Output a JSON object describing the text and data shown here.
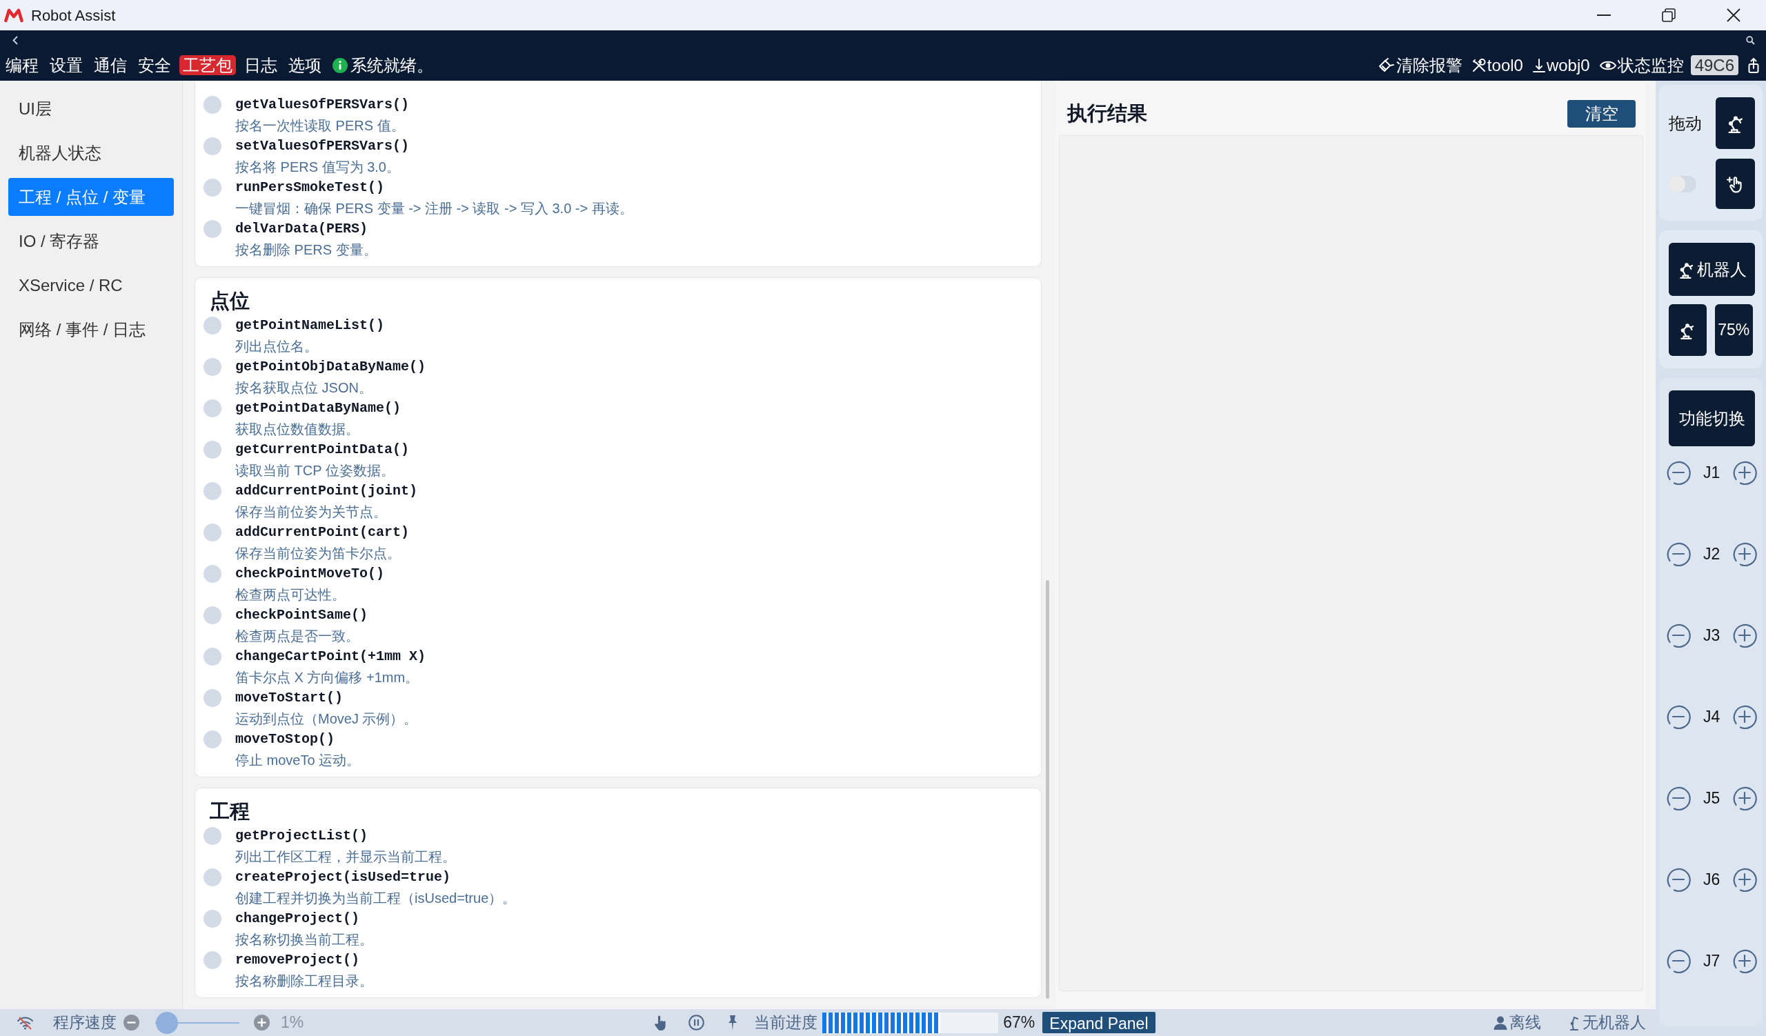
{
  "window": {
    "title": "Robot Assist"
  },
  "menu": [
    {
      "label": "编程",
      "selected": false
    },
    {
      "label": "设置",
      "selected": false
    },
    {
      "label": "通信",
      "selected": false
    },
    {
      "label": "安全",
      "selected": false
    },
    {
      "label": "工艺包",
      "selected": true
    },
    {
      "label": "日志",
      "selected": false
    },
    {
      "label": "选项",
      "selected": false
    }
  ],
  "system_status": "系统就绪。",
  "toolbar": [
    {
      "kind": "alarm",
      "label": "清除报警"
    },
    {
      "kind": "tool",
      "label": "tool0"
    },
    {
      "kind": "workobject",
      "label": "wobj0"
    },
    {
      "kind": "monitor",
      "label": "状态监控"
    }
  ],
  "device_badge": "49C6",
  "sidebar": {
    "items": [
      {
        "label": "UI层",
        "selected": false
      },
      {
        "label": "机器人状态",
        "selected": false
      },
      {
        "label": "工程 / 点位 / 变量",
        "selected": true
      },
      {
        "label": "IO / 寄存器",
        "selected": false
      },
      {
        "label": "XService / RC",
        "selected": false
      },
      {
        "label": "网络 / 事件 / 日志",
        "selected": false
      }
    ]
  },
  "sections": [
    {
      "items": [
        {
          "name": "getValuesOfPERSVars()",
          "description": "按名一次性读取 PERS 值。"
        },
        {
          "name": "setValuesOfPERSVars()",
          "description": "按名将 PERS 值写为 3.0。"
        },
        {
          "name": "runPersSmokeTest()",
          "description": "一键冒烟：确保 PERS 变量 -> 注册 -> 读取 -> 写入 3.0 -> 再读。"
        },
        {
          "name": "delVarData(PERS)",
          "description": "按名删除 PERS 变量。"
        }
      ]
    },
    {
      "title": "点位",
      "items": [
        {
          "name": "getPointNameList()",
          "description": "列出点位名。"
        },
        {
          "name": "getPointObjDataByName()",
          "description": "按名获取点位 JSON。"
        },
        {
          "name": "getPointDataByName()",
          "description": "获取点位数值数据。"
        },
        {
          "name": "getCurrentPointData()",
          "description": "读取当前 TCP 位姿数据。"
        },
        {
          "name": "addCurrentPoint(joint)",
          "description": "保存当前位姿为关节点。"
        },
        {
          "name": "addCurrentPoint(cart)",
          "description": "保存当前位姿为笛卡尔点。"
        },
        {
          "name": "checkPointMoveTo()",
          "description": "检查两点可达性。"
        },
        {
          "name": "checkPointSame()",
          "description": "检查两点是否一致。"
        },
        {
          "name": "changeCartPoint(+1mm X)",
          "description": "笛卡尔点 X 方向偏移 +1mm。"
        },
        {
          "name": "moveToStart()",
          "description": "运动到点位（MoveJ 示例）。"
        },
        {
          "name": "moveToStop()",
          "description": "停止 moveTo 运动。"
        }
      ]
    },
    {
      "title": "工程",
      "items": [
        {
          "name": "getProjectList()",
          "description": "列出工作区工程，并显示当前工程。"
        },
        {
          "name": "createProject(isUsed=true)",
          "description": "创建工程并切换为当前工程（isUsed=true）。"
        },
        {
          "name": "changeProject()",
          "description": "按名称切换当前工程。"
        },
        {
          "name": "removeProject()",
          "description": "按名称删除工程目录。"
        }
      ]
    }
  ],
  "result_panel": {
    "title": "执行结果",
    "clear_button": "清空"
  },
  "jog_panel": {
    "drag_label": "拖动",
    "drag_toggle": {
      "on": false
    },
    "robot_button": "机器人",
    "speed_button": "75%",
    "mode_button": "功能切换",
    "joints": [
      {
        "label": "J1"
      },
      {
        "label": "J2"
      },
      {
        "label": "J3"
      },
      {
        "label": "J4"
      },
      {
        "label": "J5"
      },
      {
        "label": "J6"
      },
      {
        "label": "J7"
      }
    ]
  },
  "status_bar": {
    "speed_label": "程序速度",
    "speed": {
      "level": 0.01
    },
    "speed_reading": "1%",
    "progress_label": "当前进度",
    "progress": {
      "level": 0.67
    },
    "progress_reading": "67%",
    "expand_button": "Expand Panel",
    "connection": "离线",
    "robot": "无机器人"
  }
}
